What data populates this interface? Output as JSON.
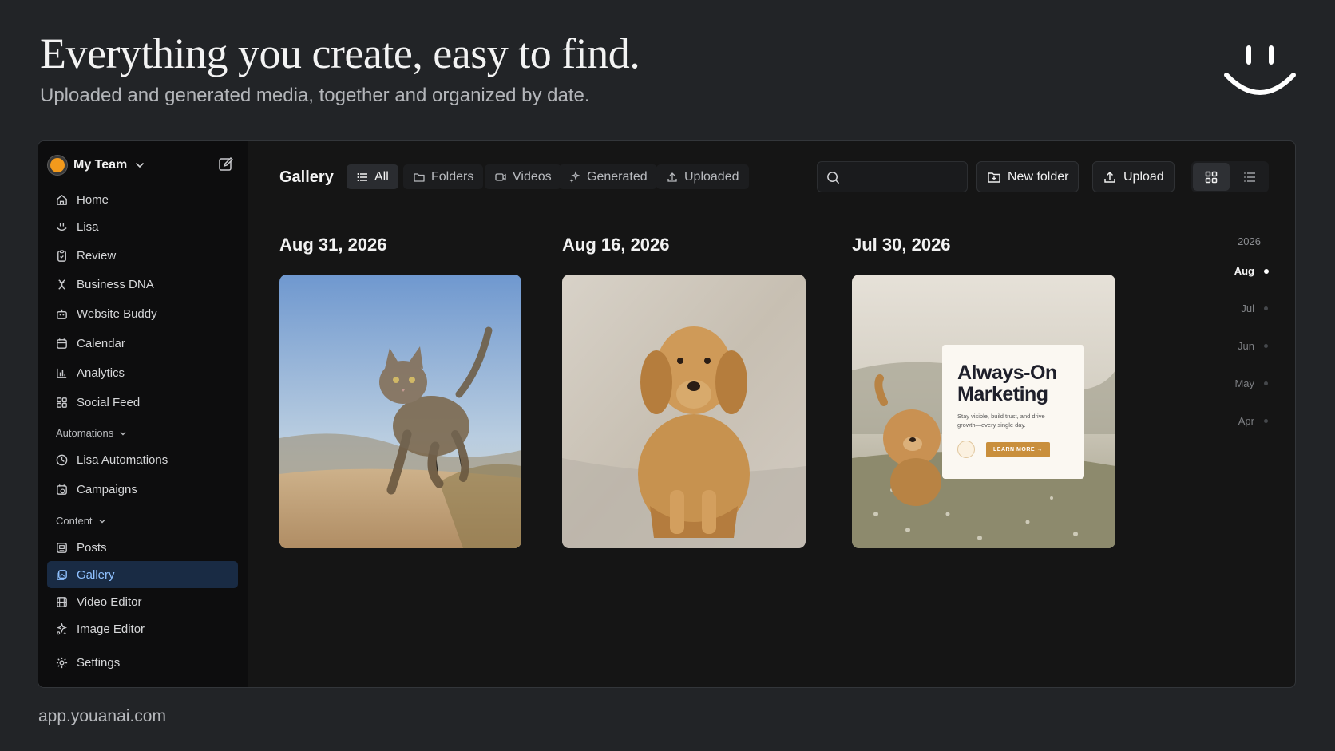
{
  "hero": {
    "title": "Everything you create, easy to find.",
    "subtitle": "Uploaded and generated media, together and organized by date."
  },
  "footer": {
    "url": "app.youanai.com"
  },
  "sidebar": {
    "team_name": "My Team",
    "items": [
      {
        "label": "Home",
        "icon": "home-icon"
      },
      {
        "label": "Lisa",
        "icon": "smile-icon"
      },
      {
        "label": "Review",
        "icon": "clipboard-icon"
      },
      {
        "label": "Business DNA",
        "icon": "dna-icon"
      },
      {
        "label": "Website Buddy",
        "icon": "bot-icon"
      },
      {
        "label": "Calendar",
        "icon": "calendar-icon"
      },
      {
        "label": "Analytics",
        "icon": "bar-chart-icon"
      },
      {
        "label": "Social Feed",
        "icon": "grid-icon"
      }
    ],
    "automations_label": "Automations",
    "automation_items": [
      {
        "label": "Lisa Automations",
        "icon": "clock-icon"
      },
      {
        "label": "Campaigns",
        "icon": "calendar-clock-icon"
      }
    ],
    "content_label": "Content",
    "content_items": [
      {
        "label": "Posts",
        "icon": "posts-icon"
      },
      {
        "label": "Gallery",
        "icon": "gallery-icon",
        "active": true
      },
      {
        "label": "Video Editor",
        "icon": "film-icon"
      },
      {
        "label": "Image Editor",
        "icon": "sparkle-image-icon"
      }
    ],
    "settings_label": "Settings"
  },
  "toolbar": {
    "title": "Gallery",
    "filters": [
      "All",
      "Folders",
      "Videos",
      "Generated",
      "Uploaded"
    ],
    "active_filter": "All",
    "search_value": "",
    "new_folder_label": "New folder",
    "upload_label": "Upload",
    "view_mode": "grid"
  },
  "groups": [
    {
      "date": "Aug 31, 2026",
      "item": "cat-photo"
    },
    {
      "date": "Aug 16, 2026",
      "item": "dog-photo"
    },
    {
      "date": "Jul 30, 2026",
      "item": "marketing-post"
    }
  ],
  "marketing_card": {
    "headline_line1": "Always-On",
    "headline_line2": "Marketing",
    "body_line1": "Stay visible, build trust, and drive",
    "body_line2": "growth—every single day.",
    "cta": "LEARN MORE →"
  },
  "timeline": {
    "year": "2026",
    "months": [
      "Aug",
      "Jul",
      "Jun",
      "May",
      "Apr"
    ],
    "active_month": "Aug"
  },
  "colors": {
    "background": "#222427",
    "active_nav_bg": "#192b44",
    "active_nav_text": "#8fc1ff",
    "accent_orange": "#f39a1c",
    "cta_gold": "#c98f3c"
  }
}
